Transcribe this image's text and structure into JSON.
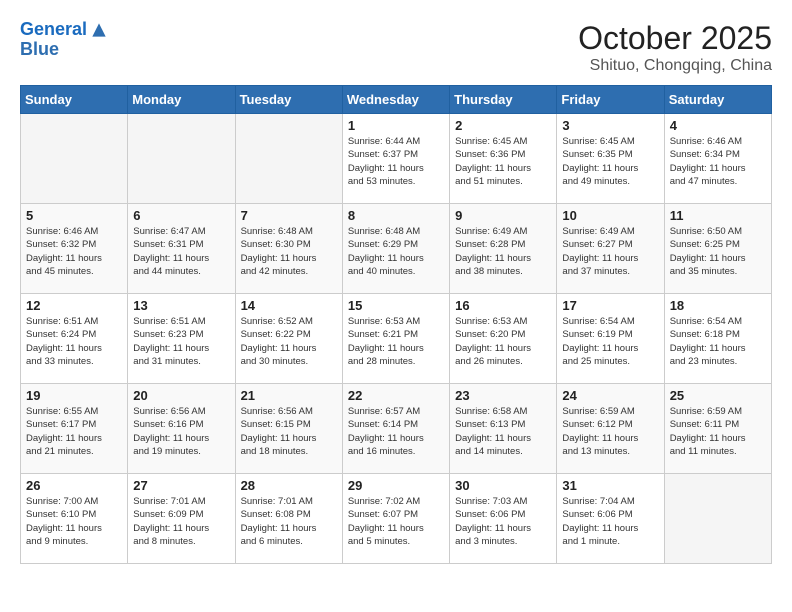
{
  "logo": {
    "line1": "General",
    "line2": "Blue"
  },
  "title": "October 2025",
  "subtitle": "Shituo, Chongqing, China",
  "days_of_week": [
    "Sunday",
    "Monday",
    "Tuesday",
    "Wednesday",
    "Thursday",
    "Friday",
    "Saturday"
  ],
  "weeks": [
    [
      {
        "day": "",
        "info": ""
      },
      {
        "day": "",
        "info": ""
      },
      {
        "day": "",
        "info": ""
      },
      {
        "day": "1",
        "info": "Sunrise: 6:44 AM\nSunset: 6:37 PM\nDaylight: 11 hours\nand 53 minutes."
      },
      {
        "day": "2",
        "info": "Sunrise: 6:45 AM\nSunset: 6:36 PM\nDaylight: 11 hours\nand 51 minutes."
      },
      {
        "day": "3",
        "info": "Sunrise: 6:45 AM\nSunset: 6:35 PM\nDaylight: 11 hours\nand 49 minutes."
      },
      {
        "day": "4",
        "info": "Sunrise: 6:46 AM\nSunset: 6:34 PM\nDaylight: 11 hours\nand 47 minutes."
      }
    ],
    [
      {
        "day": "5",
        "info": "Sunrise: 6:46 AM\nSunset: 6:32 PM\nDaylight: 11 hours\nand 45 minutes."
      },
      {
        "day": "6",
        "info": "Sunrise: 6:47 AM\nSunset: 6:31 PM\nDaylight: 11 hours\nand 44 minutes."
      },
      {
        "day": "7",
        "info": "Sunrise: 6:48 AM\nSunset: 6:30 PM\nDaylight: 11 hours\nand 42 minutes."
      },
      {
        "day": "8",
        "info": "Sunrise: 6:48 AM\nSunset: 6:29 PM\nDaylight: 11 hours\nand 40 minutes."
      },
      {
        "day": "9",
        "info": "Sunrise: 6:49 AM\nSunset: 6:28 PM\nDaylight: 11 hours\nand 38 minutes."
      },
      {
        "day": "10",
        "info": "Sunrise: 6:49 AM\nSunset: 6:27 PM\nDaylight: 11 hours\nand 37 minutes."
      },
      {
        "day": "11",
        "info": "Sunrise: 6:50 AM\nSunset: 6:25 PM\nDaylight: 11 hours\nand 35 minutes."
      }
    ],
    [
      {
        "day": "12",
        "info": "Sunrise: 6:51 AM\nSunset: 6:24 PM\nDaylight: 11 hours\nand 33 minutes."
      },
      {
        "day": "13",
        "info": "Sunrise: 6:51 AM\nSunset: 6:23 PM\nDaylight: 11 hours\nand 31 minutes."
      },
      {
        "day": "14",
        "info": "Sunrise: 6:52 AM\nSunset: 6:22 PM\nDaylight: 11 hours\nand 30 minutes."
      },
      {
        "day": "15",
        "info": "Sunrise: 6:53 AM\nSunset: 6:21 PM\nDaylight: 11 hours\nand 28 minutes."
      },
      {
        "day": "16",
        "info": "Sunrise: 6:53 AM\nSunset: 6:20 PM\nDaylight: 11 hours\nand 26 minutes."
      },
      {
        "day": "17",
        "info": "Sunrise: 6:54 AM\nSunset: 6:19 PM\nDaylight: 11 hours\nand 25 minutes."
      },
      {
        "day": "18",
        "info": "Sunrise: 6:54 AM\nSunset: 6:18 PM\nDaylight: 11 hours\nand 23 minutes."
      }
    ],
    [
      {
        "day": "19",
        "info": "Sunrise: 6:55 AM\nSunset: 6:17 PM\nDaylight: 11 hours\nand 21 minutes."
      },
      {
        "day": "20",
        "info": "Sunrise: 6:56 AM\nSunset: 6:16 PM\nDaylight: 11 hours\nand 19 minutes."
      },
      {
        "day": "21",
        "info": "Sunrise: 6:56 AM\nSunset: 6:15 PM\nDaylight: 11 hours\nand 18 minutes."
      },
      {
        "day": "22",
        "info": "Sunrise: 6:57 AM\nSunset: 6:14 PM\nDaylight: 11 hours\nand 16 minutes."
      },
      {
        "day": "23",
        "info": "Sunrise: 6:58 AM\nSunset: 6:13 PM\nDaylight: 11 hours\nand 14 minutes."
      },
      {
        "day": "24",
        "info": "Sunrise: 6:59 AM\nSunset: 6:12 PM\nDaylight: 11 hours\nand 13 minutes."
      },
      {
        "day": "25",
        "info": "Sunrise: 6:59 AM\nSunset: 6:11 PM\nDaylight: 11 hours\nand 11 minutes."
      }
    ],
    [
      {
        "day": "26",
        "info": "Sunrise: 7:00 AM\nSunset: 6:10 PM\nDaylight: 11 hours\nand 9 minutes."
      },
      {
        "day": "27",
        "info": "Sunrise: 7:01 AM\nSunset: 6:09 PM\nDaylight: 11 hours\nand 8 minutes."
      },
      {
        "day": "28",
        "info": "Sunrise: 7:01 AM\nSunset: 6:08 PM\nDaylight: 11 hours\nand 6 minutes."
      },
      {
        "day": "29",
        "info": "Sunrise: 7:02 AM\nSunset: 6:07 PM\nDaylight: 11 hours\nand 5 minutes."
      },
      {
        "day": "30",
        "info": "Sunrise: 7:03 AM\nSunset: 6:06 PM\nDaylight: 11 hours\nand 3 minutes."
      },
      {
        "day": "31",
        "info": "Sunrise: 7:04 AM\nSunset: 6:06 PM\nDaylight: 11 hours\nand 1 minute."
      },
      {
        "day": "",
        "info": ""
      }
    ]
  ]
}
